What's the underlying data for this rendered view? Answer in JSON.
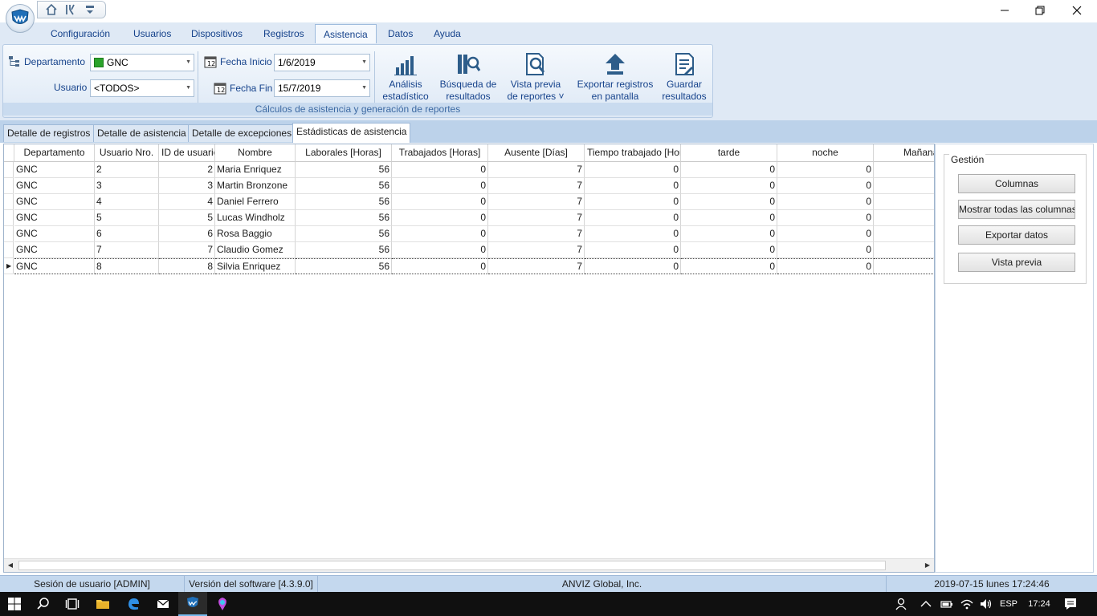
{
  "ribbon": {
    "tabs": [
      "Configuración",
      "Usuarios",
      "Dispositivos",
      "Registros",
      "Asistencia",
      "Datos",
      "Ayuda"
    ],
    "active_tab": "Asistencia",
    "filters": {
      "department_label": "Departamento",
      "department_value": "GNC",
      "user_label": "Usuario",
      "user_value": "<TODOS>",
      "start_label": "Fecha Inicio",
      "start_value": "1/6/2019",
      "end_label": "Fecha Fin",
      "end_value": "15/7/2019"
    },
    "buttons": {
      "analysis_l1": "Análisis",
      "analysis_l2": "estadístico",
      "search_l1": "Búsqueda de",
      "search_l2": "resultados",
      "preview_l1": "Vista previa",
      "preview_l2": "de reportes ˅",
      "export_l1": "Exportar registros",
      "export_l2": "en pantalla",
      "save_l1": "Guardar",
      "save_l2": "resultados"
    },
    "group_label": "Cálculos de asistencia y generación de reportes"
  },
  "sub_tabs": [
    "Detalle de registros",
    "Detalle de asistencia",
    "Detalle de excepciones",
    "Estádisticas de asistencia"
  ],
  "grid": {
    "columns": [
      "Departamento",
      "Usuario Nro.",
      "ID de usuario",
      "Nombre",
      "Laborales [Horas]",
      "Trabajados [Horas]",
      "Ausente [Días]",
      "Tiempo trabajado [Horas]",
      "tarde",
      "noche",
      "Mañana"
    ],
    "rows": [
      [
        "GNC",
        "2",
        "2",
        "Maria Enriquez",
        "56",
        "0",
        "7",
        "0",
        "0",
        "0"
      ],
      [
        "GNC",
        "3",
        "3",
        "Martin Bronzone",
        "56",
        "0",
        "7",
        "0",
        "0",
        "0"
      ],
      [
        "GNC",
        "4",
        "4",
        "Daniel Ferrero",
        "56",
        "0",
        "7",
        "0",
        "0",
        "0"
      ],
      [
        "GNC",
        "5",
        "5",
        "Lucas Windholz",
        "56",
        "0",
        "7",
        "0",
        "0",
        "0"
      ],
      [
        "GNC",
        "6",
        "6",
        "Rosa Baggio",
        "56",
        "0",
        "7",
        "0",
        "0",
        "0"
      ],
      [
        "GNC",
        "7",
        "7",
        "Claudio Gomez",
        "56",
        "0",
        "7",
        "0",
        "0",
        "0"
      ],
      [
        "GNC",
        "8",
        "8",
        "Silvia Enriquez",
        "56",
        "0",
        "7",
        "0",
        "0",
        "0"
      ]
    ],
    "selected_row": 6
  },
  "panel": {
    "title": "Gestión",
    "buttons": [
      "Columnas",
      "Mostrar todas las columnas",
      "Exportar datos",
      "Vista previa"
    ]
  },
  "status": {
    "session": "Sesión de usuario  [ADMIN]",
    "version": "Versión del software  [4.3.9.0]",
    "company": "ANVIZ Global, Inc.",
    "datetime": "2019-07-15 lunes 17:24:46"
  },
  "taskbar": {
    "lang": "ESP",
    "time": "17:24"
  },
  "colors": {
    "ribbon_bg": "#dfe9f5",
    "ribbon_text": "#15428b",
    "status_bg": "#c4d8ee",
    "taskbar_bg": "#101010"
  }
}
